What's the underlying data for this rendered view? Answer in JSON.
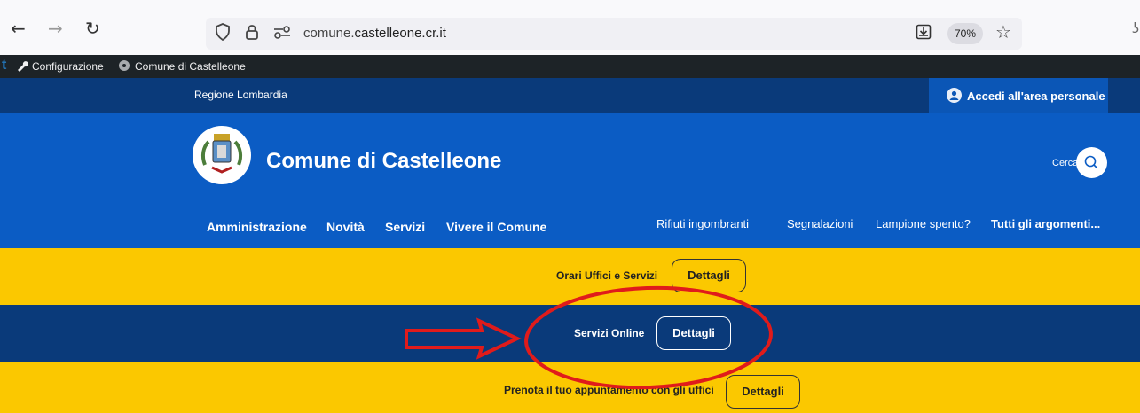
{
  "browser": {
    "url_prefix": "comune.",
    "url_host": "castelleone.cr.it",
    "zoom": "70%"
  },
  "admin_bar": {
    "items": [
      "Configurazione",
      "Comune di Castelleone"
    ]
  },
  "header": {
    "region": "Regione Lombardia",
    "login": "Accedi all'area personale",
    "site_title": "Comune di Castelleone",
    "search_label": "Cerca"
  },
  "menu": {
    "primary": [
      "Amministrazione",
      "Novità",
      "Servizi",
      "Vivere il Comune"
    ],
    "secondary": [
      "Rifiuti ingombranti",
      "Segnalazioni",
      "Lampione spento?",
      "Tutti gli argomenti..."
    ]
  },
  "bands": [
    {
      "label": "Orari Uffici e Servizi",
      "button": "Dettagli"
    },
    {
      "label": "Servizi Online",
      "button": "Dettagli"
    },
    {
      "label": "Prenota il tuo appuntamento con gli uffici",
      "button": "Dettagli"
    }
  ],
  "colors": {
    "header_blue": "#0b5cc4",
    "dark_blue": "#0a3a7a",
    "yellow": "#fbc800",
    "annotation_red": "#e01b1b"
  }
}
